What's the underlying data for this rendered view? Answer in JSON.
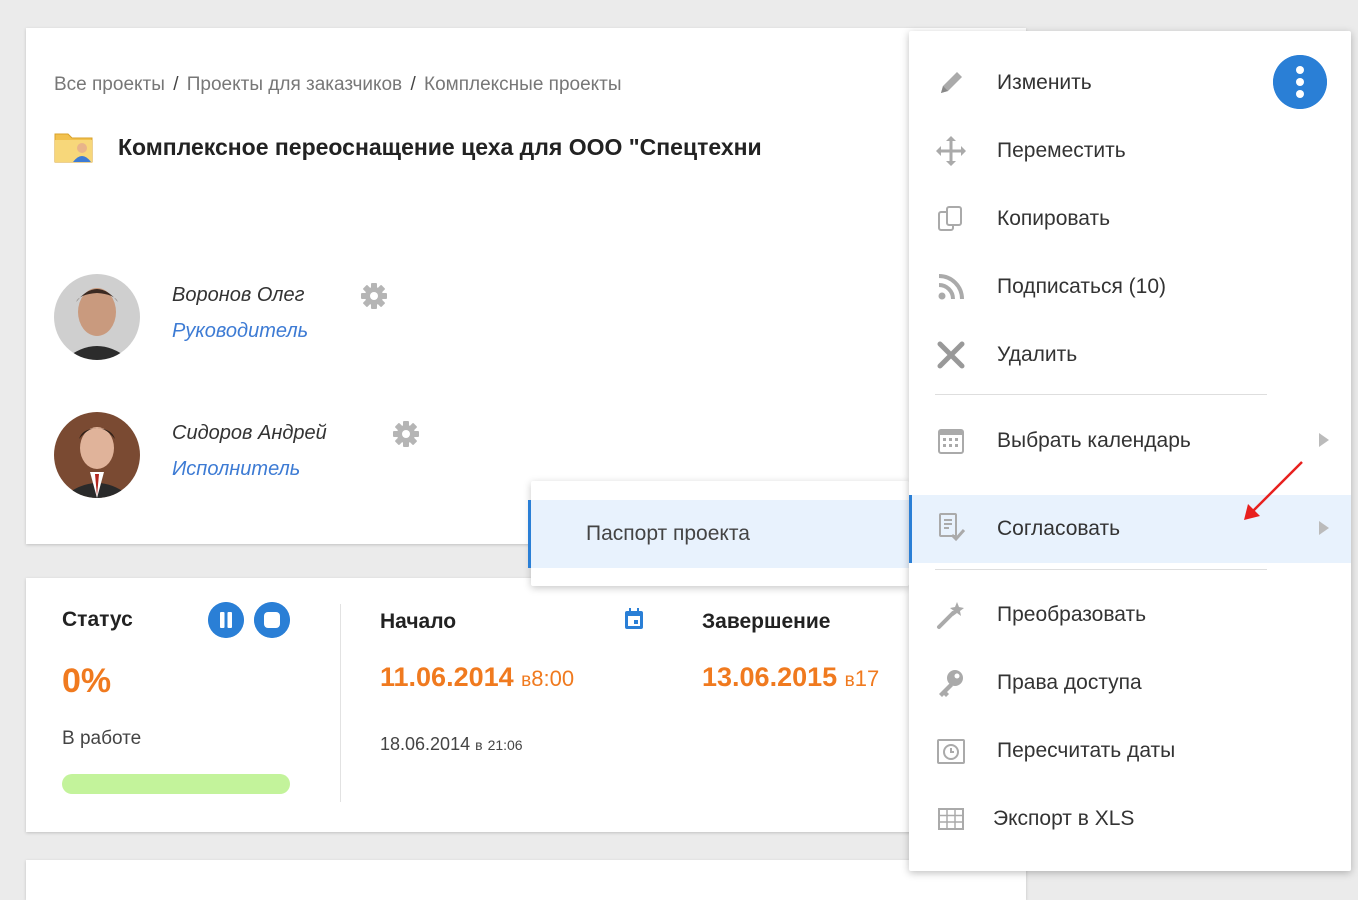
{
  "breadcrumb": {
    "items": [
      "Все проекты",
      "Проекты для заказчиков",
      "Комплексные проекты"
    ],
    "separator": "/"
  },
  "project": {
    "title": "Комплексное переоснащение цеха для ООО \"Спецтехни",
    "icon": "folder-user-icon"
  },
  "members": [
    {
      "name": "Воронов Олег",
      "role": "Руководитель"
    },
    {
      "name": "Сидоров Андрей",
      "role": "Исполнитель"
    }
  ],
  "status": {
    "label": "Статус",
    "percent": "0%",
    "state": "В работе",
    "progress_fraction": 0.0,
    "controls": [
      "pause-icon",
      "stop-icon"
    ]
  },
  "start": {
    "label": "Начало",
    "date": "11.06.2014",
    "at": "в",
    "time": "8:00",
    "actual_date": "18.06.2014",
    "actual_at": "в",
    "actual_time": "21:06"
  },
  "finish": {
    "label": "Завершение",
    "date": "13.06.2015",
    "at": "в",
    "time": "17"
  },
  "menu": {
    "items": [
      {
        "label": "Изменить",
        "icon": "pencil-icon"
      },
      {
        "label": "Переместить",
        "icon": "move-icon"
      },
      {
        "label": "Копировать",
        "icon": "copy-icon"
      },
      {
        "label": "Подписаться (10)",
        "icon": "rss-icon"
      },
      {
        "label": "Удалить",
        "icon": "close-icon"
      },
      {
        "label": "Выбрать календарь",
        "icon": "calendar-icon"
      },
      {
        "label": "Согласовать",
        "icon": "approve-document-icon"
      },
      {
        "label": "Преобразовать",
        "icon": "magic-wand-icon"
      },
      {
        "label": "Права доступа",
        "icon": "key-icon"
      },
      {
        "label": "Пересчитать даты",
        "icon": "recalc-dates-icon"
      },
      {
        "label": "Экспорт в XLS",
        "icon": "table-icon"
      }
    ],
    "active_item": "Согласовать"
  },
  "submenu": {
    "items": [
      "Паспорт проекта"
    ]
  },
  "colors": {
    "accent": "#2a7fd6",
    "orange": "#f07a1f",
    "progress": "#c3f39b",
    "link": "#3d7bd4"
  }
}
